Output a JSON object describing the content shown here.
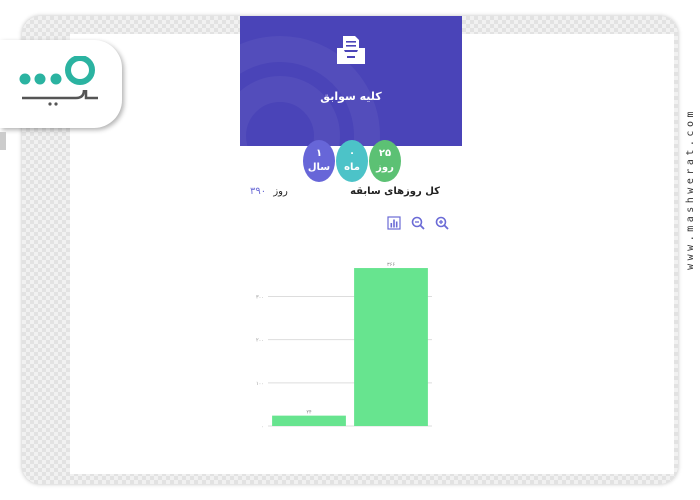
{
  "logo": {
    "brand_text": "مشورت",
    "icon_name": "mashwerat-logo-icon",
    "color": "#2bb3a1"
  },
  "watermark": "www.mashwerat.com",
  "header": {
    "title": "کلیه سوابق",
    "icon_name": "folder-tray-icon",
    "background": "#4a44b8"
  },
  "summary": {
    "day": {
      "value": "۲۵",
      "unit": "روز",
      "color": "#5cc174"
    },
    "month": {
      "value": "۰",
      "unit": "ماه",
      "color": "#4cc3c8"
    },
    "year": {
      "value": "۱",
      "unit": "سال",
      "color": "#6766d8"
    }
  },
  "total": {
    "label": "کل روزهای سابقه",
    "value": "۳۹۰",
    "unit": "روز"
  },
  "toolbar": {
    "icons": [
      "zoom-in-icon",
      "zoom-out-icon",
      "bar-chart-icon"
    ]
  },
  "chart_data": {
    "type": "bar",
    "categories": [
      "",
      ""
    ],
    "values": [
      24,
      366
    ],
    "value_labels": [
      "۲۴",
      "۳۶۶"
    ],
    "yticks": [
      0,
      100,
      200,
      300
    ],
    "ytick_labels": [
      "۰",
      "۱۰۰",
      "۲۰۰",
      "۳۰۰"
    ],
    "ylim": [
      0,
      380
    ],
    "bar_color": "#67e48f",
    "grid": true,
    "title": "",
    "xlabel": "",
    "ylabel": ""
  }
}
